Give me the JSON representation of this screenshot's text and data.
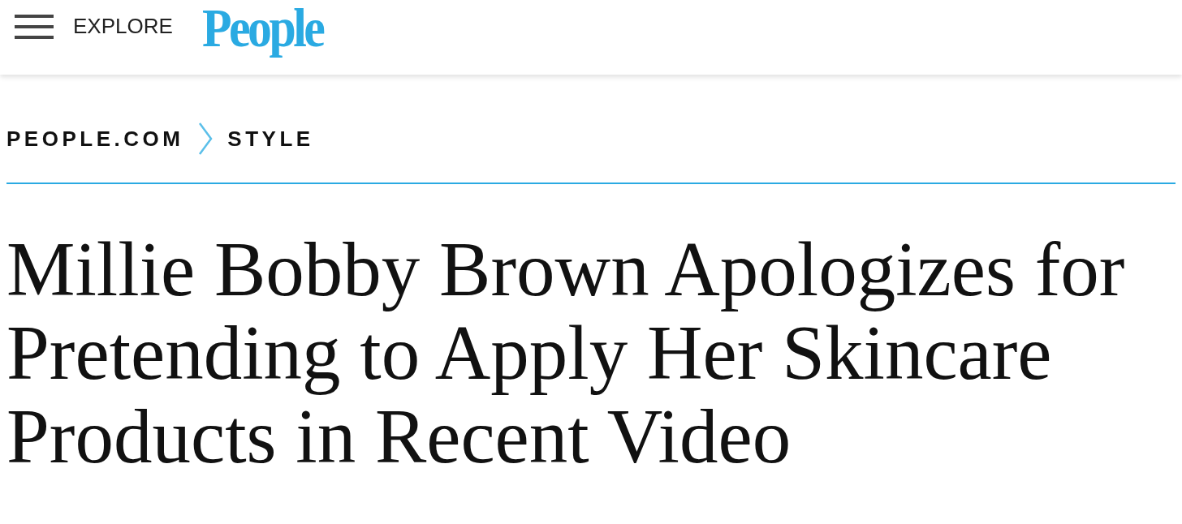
{
  "header": {
    "menu_label": "EXPLORE",
    "logo": "People"
  },
  "breadcrumb": [
    {
      "label": "PEOPLE.COM"
    },
    {
      "label": "STYLE"
    }
  ],
  "headline": "Millie Bobby Brown Apologizes for Pretending to Apply Her Skincare Products in Recent Video"
}
